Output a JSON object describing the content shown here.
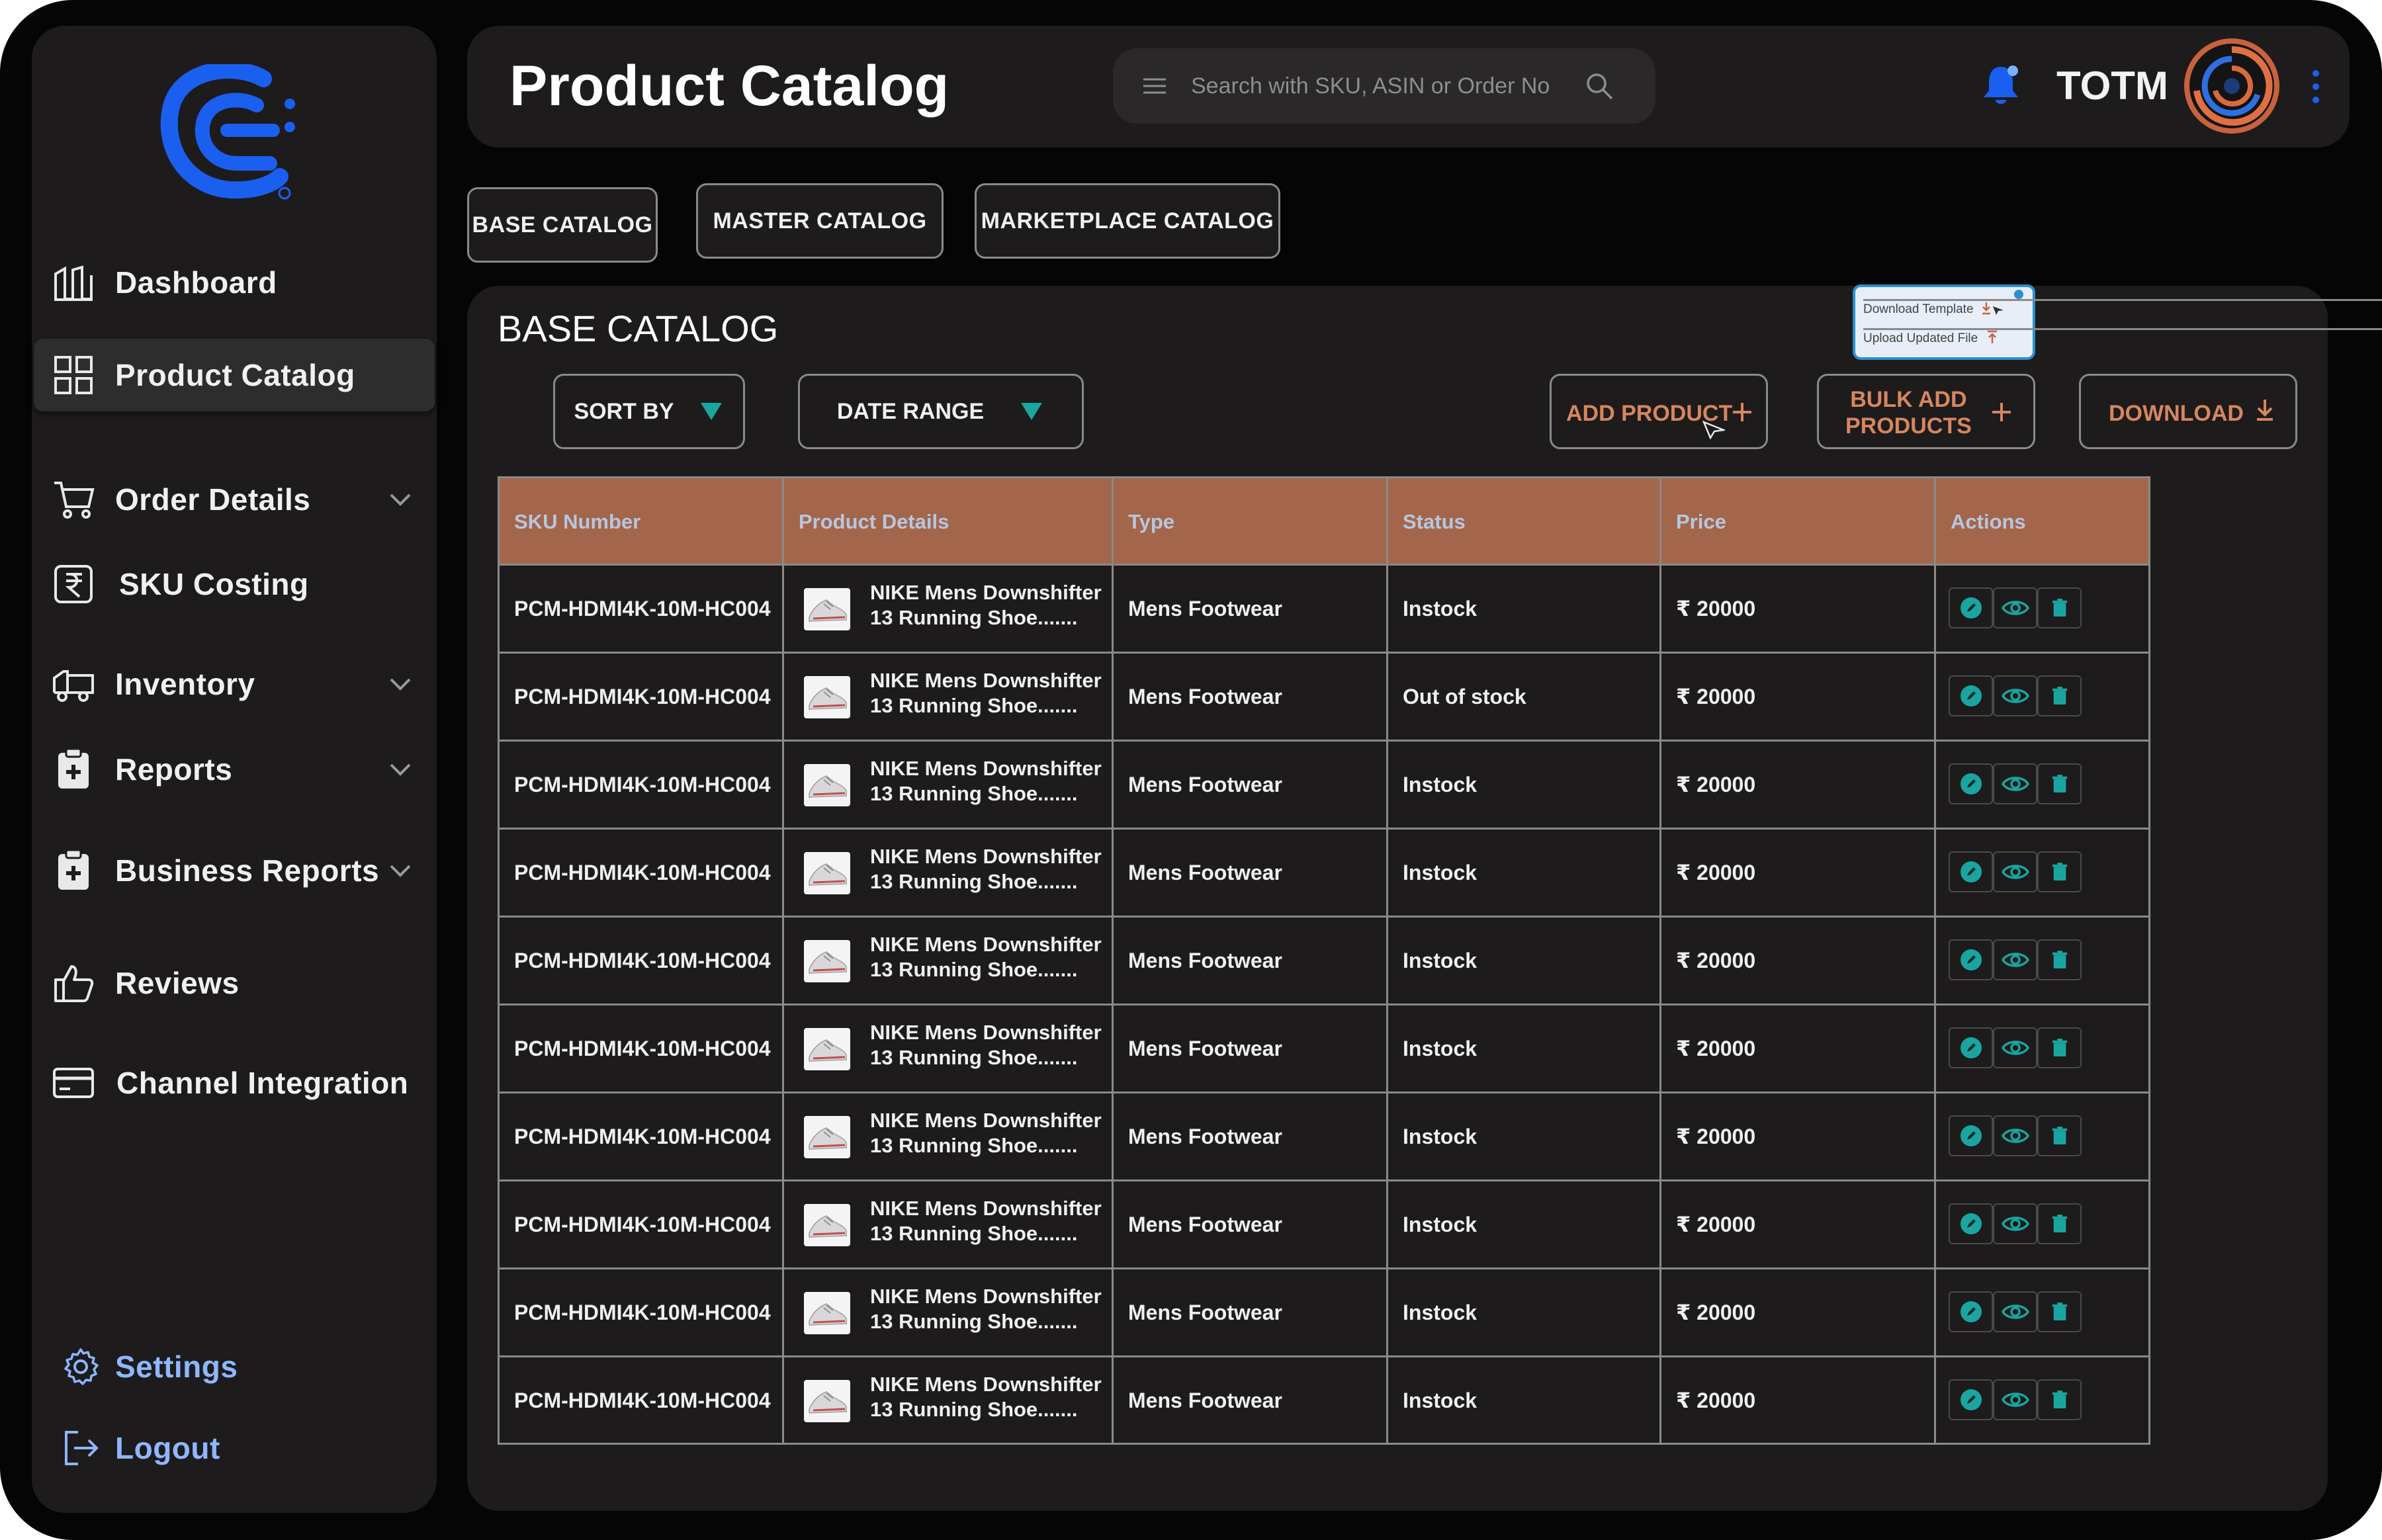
{
  "sidebar": {
    "items": [
      {
        "name": "dashboard",
        "label": "Dashboard",
        "icon": "building-columns-icon"
      },
      {
        "name": "product-catalog",
        "label": "Product Catalog",
        "icon": "grid-icon"
      },
      {
        "name": "order-details",
        "label": "Order Details",
        "icon": "cart-icon"
      },
      {
        "name": "sku-costing",
        "label": "SKU Costing",
        "icon": "rupee-icon"
      },
      {
        "name": "inventory",
        "label": "Inventory",
        "icon": "truck-icon"
      },
      {
        "name": "reports",
        "label": "Reports",
        "icon": "clipboard-plus-icon"
      },
      {
        "name": "business-reports",
        "label": "Business Reports",
        "icon": "clipboard-plus-icon"
      },
      {
        "name": "reviews",
        "label": "Reviews",
        "icon": "thumbs-up-icon"
      },
      {
        "name": "channel-integration",
        "label": "Channel Integration",
        "icon": "credit-card-icon"
      }
    ],
    "settings": "Settings",
    "logout": "Logout"
  },
  "header": {
    "title": "Product Catalog",
    "search_placeholder": "Search with SKU, ASIN or Order No",
    "username": "TOTM"
  },
  "tabs": [
    "BASE CATALOG",
    "MASTER CATALOG",
    "MARKETPLACE CATALOG"
  ],
  "main": {
    "section_title": "BASE CATALOG",
    "sort_by": "SORT BY",
    "date_range": "DATE RANGE",
    "add_product": "ADD PRODUCT",
    "bulk_add_line1": "BULK ADD",
    "bulk_add_line2": "PRODUCTS",
    "download": "DOWNLOAD",
    "popover": {
      "download_template": "Download Template",
      "upload_updated": "Upload Updated File"
    }
  },
  "table": {
    "columns": [
      "SKU Number",
      "Product Details",
      "Type",
      "Status",
      "Price",
      "Actions"
    ],
    "rows": [
      {
        "sku": "PCM-HDMI4K-10M-HC004",
        "name1": "NIKE Mens Downshifter",
        "name2": "13 Running Shoe.......",
        "type": "Mens Footwear",
        "status": "Instock",
        "price": "₹ 20000"
      },
      {
        "sku": "PCM-HDMI4K-10M-HC004",
        "name1": "NIKE Mens Downshifter",
        "name2": "13 Running Shoe.......",
        "type": "Mens Footwear",
        "status": "Out of stock",
        "price": "₹ 20000"
      },
      {
        "sku": "PCM-HDMI4K-10M-HC004",
        "name1": "NIKE Mens Downshifter",
        "name2": "13 Running Shoe.......",
        "type": "Mens Footwear",
        "status": "Instock",
        "price": "₹ 20000"
      },
      {
        "sku": "PCM-HDMI4K-10M-HC004",
        "name1": "NIKE Mens Downshifter",
        "name2": "13 Running Shoe.......",
        "type": "Mens Footwear",
        "status": "Instock",
        "price": "₹ 20000"
      },
      {
        "sku": "PCM-HDMI4K-10M-HC004",
        "name1": "NIKE Mens Downshifter",
        "name2": "13 Running Shoe.......",
        "type": "Mens Footwear",
        "status": "Instock",
        "price": "₹ 20000"
      },
      {
        "sku": "PCM-HDMI4K-10M-HC004",
        "name1": "NIKE Mens Downshifter",
        "name2": "13 Running Shoe.......",
        "type": "Mens Footwear",
        "status": "Instock",
        "price": "₹ 20000"
      },
      {
        "sku": "PCM-HDMI4K-10M-HC004",
        "name1": "NIKE Mens Downshifter",
        "name2": "13 Running Shoe.......",
        "type": "Mens Footwear",
        "status": "Instock",
        "price": "₹ 20000"
      },
      {
        "sku": "PCM-HDMI4K-10M-HC004",
        "name1": "NIKE Mens Downshifter",
        "name2": "13 Running Shoe.......",
        "type": "Mens Footwear",
        "status": "Instock",
        "price": "₹ 20000"
      },
      {
        "sku": "PCM-HDMI4K-10M-HC004",
        "name1": "NIKE Mens Downshifter",
        "name2": "13 Running Shoe.......",
        "type": "Mens Footwear",
        "status": "Instock",
        "price": "₹ 20000"
      },
      {
        "sku": "PCM-HDMI4K-10M-HC004",
        "name1": "NIKE Mens Downshifter",
        "name2": "13 Running Shoe.......",
        "type": "Mens Footwear",
        "status": "Instock",
        "price": "₹ 20000"
      }
    ]
  },
  "colors": {
    "accent_blue": "#1a5ff0",
    "header_brown": "#a3664a",
    "action_orange": "#d6865f",
    "icon_teal": "#1aa5a0"
  }
}
